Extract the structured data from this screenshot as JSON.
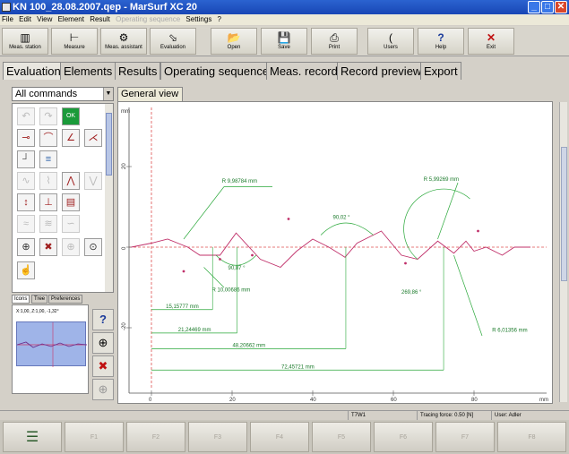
{
  "window": {
    "title": "KN 100_28.08.2007.qep - MarSurf XC 20"
  },
  "menu": [
    "File",
    "Edit",
    "View",
    "Element",
    "Result",
    "Operating sequence",
    "Settings",
    "?"
  ],
  "toolbar": [
    {
      "label": "Meas. station",
      "icon": "station-icon",
      "glyph": "▥"
    },
    {
      "label": "Measure",
      "icon": "measure-icon",
      "glyph": "⊢"
    },
    {
      "label": "Meas. assistant",
      "icon": "assistant-icon",
      "glyph": "⚙"
    },
    {
      "label": "Evaluation",
      "icon": "evaluation-icon",
      "glyph": "⬂"
    },
    {
      "label": "Open",
      "icon": "open-folder-icon",
      "glyph": "📂"
    },
    {
      "label": "Save",
      "icon": "save-disk-icon",
      "glyph": "💾"
    },
    {
      "label": "Print",
      "icon": "printer-icon",
      "glyph": "⎙"
    },
    {
      "label": "Users",
      "icon": "users-icon",
      "glyph": "("
    },
    {
      "label": "Help",
      "icon": "help-icon",
      "glyph": "?"
    },
    {
      "label": "Exit",
      "icon": "exit-icon",
      "glyph": "✕"
    }
  ],
  "tabs": [
    "Evaluation",
    "Elements",
    "Results",
    "Operating sequence",
    "Meas. record",
    "Record preview",
    "Export"
  ],
  "commands": {
    "selected": "All commands",
    "sub_tabs": [
      "Icons",
      "Tree",
      "Preferences"
    ],
    "preview_label": "X:1,00, Z:1,00, -1,32°"
  },
  "general_view": {
    "tab": "General view"
  },
  "chart_data": {
    "type": "line",
    "x_unit": "mm",
    "y_unit": "mm",
    "xlim": [
      -5,
      95
    ],
    "ylim": [
      -35,
      35
    ],
    "x_ticks": [
      0,
      20,
      40,
      60,
      80
    ],
    "y_ticks": [
      20,
      0,
      -20
    ],
    "profile": [
      [
        -5,
        0
      ],
      [
        0,
        1
      ],
      [
        4,
        2
      ],
      [
        9,
        0
      ],
      [
        12,
        -2
      ],
      [
        17,
        -2
      ],
      [
        21,
        3.5
      ],
      [
        27,
        -3
      ],
      [
        32,
        -5
      ],
      [
        36,
        -1
      ],
      [
        40,
        2
      ],
      [
        44,
        0
      ],
      [
        48,
        -2.5
      ],
      [
        51,
        1
      ],
      [
        57,
        4
      ],
      [
        62,
        -2
      ],
      [
        66,
        -3
      ],
      [
        71,
        1.5
      ],
      [
        75,
        -1.5
      ],
      [
        78,
        1.5
      ],
      [
        80,
        -1
      ],
      [
        83,
        0
      ],
      [
        87,
        -2
      ],
      [
        90,
        0
      ],
      [
        94,
        0
      ]
    ],
    "annotations": {
      "radius_1": "R 9,98784 mm",
      "radius_2": "R 10,00686 mm",
      "radius_3": "R 5,99269 mm",
      "radius_4": "R 6,01356 mm",
      "angle_1": "90,87 °",
      "angle_2": "90,02 °",
      "angle_3": "269,86 °",
      "dim_1": "15,15777 mm",
      "dim_2": "21,24469 mm",
      "dim_3": "48,20662 mm",
      "dim_4": "72,45721 mm"
    }
  },
  "status": {
    "item_1": "T7W1",
    "item_2": "Tracing force: 0.50 [N]",
    "item_3": "User: Adler"
  },
  "fkeys": [
    "F1",
    "F2",
    "F3",
    "F4",
    "F5",
    "F6",
    "F7",
    "F8"
  ],
  "fkey_lead_icon": "stack-icon"
}
